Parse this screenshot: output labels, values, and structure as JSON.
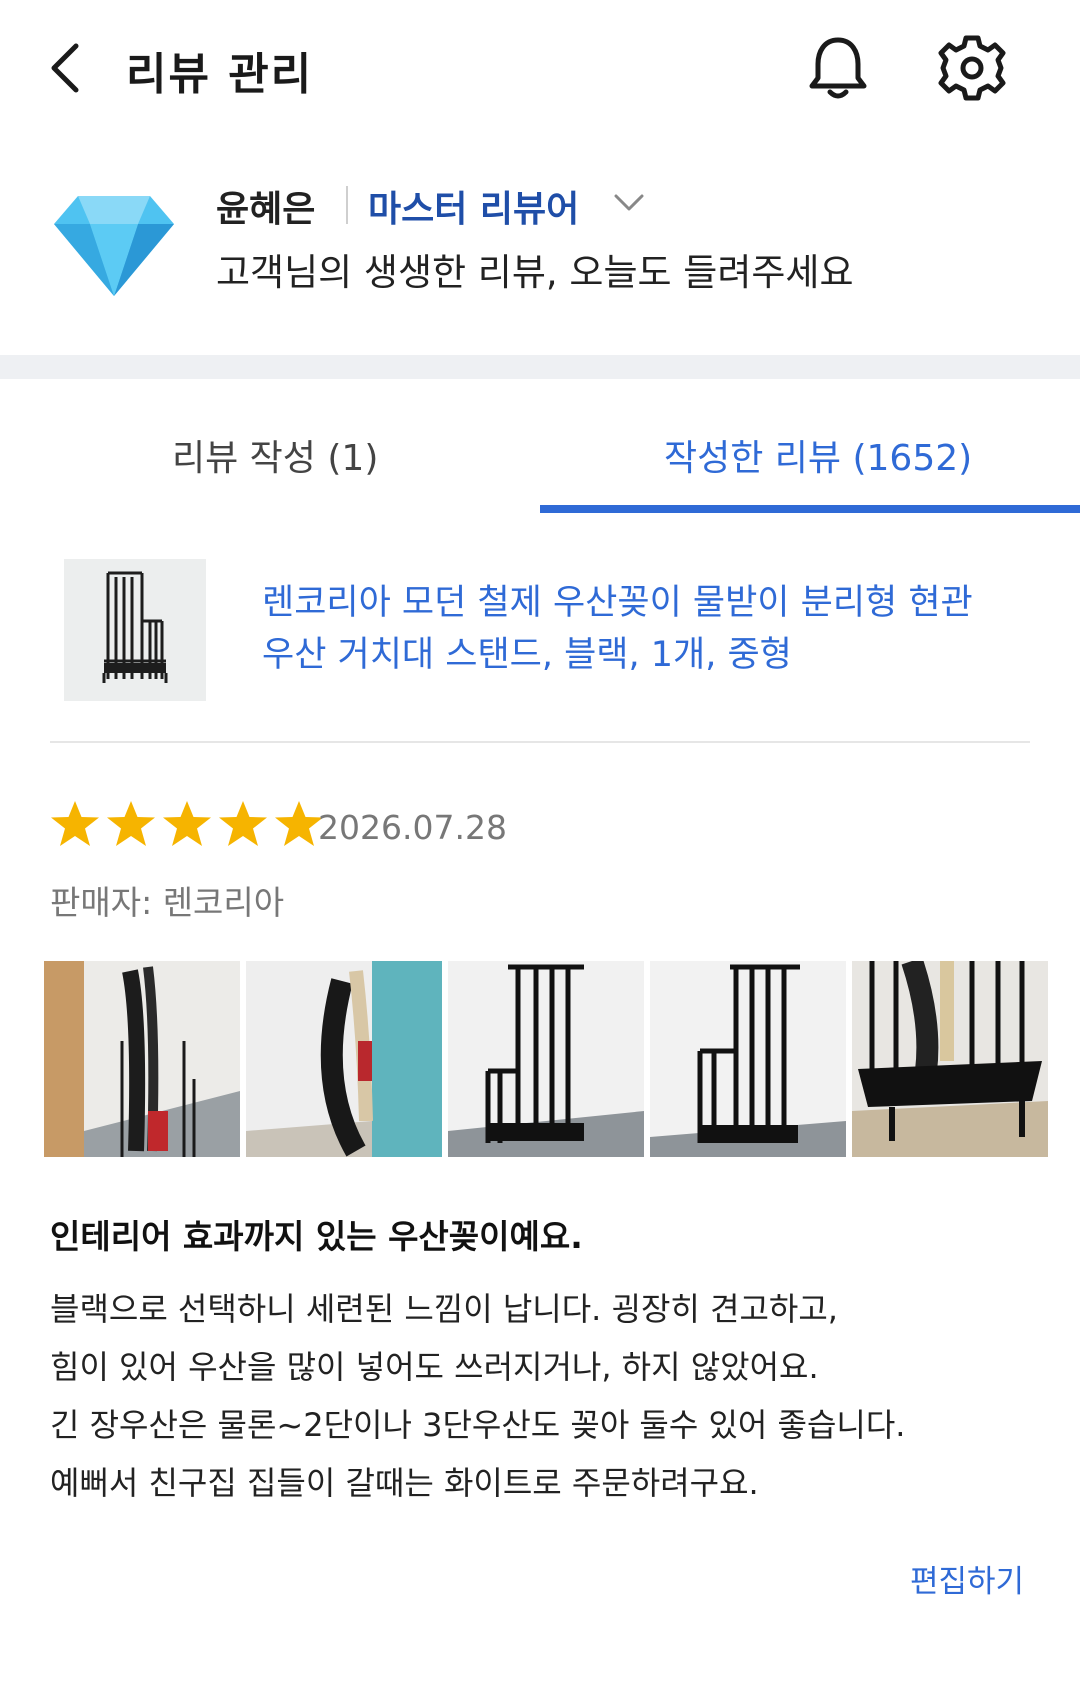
{
  "header": {
    "title": "리뷰 관리",
    "back_icon": "chevron-left-icon",
    "bell_icon": "bell-icon",
    "settings_icon": "gear-icon"
  },
  "profile": {
    "badge_icon": "diamond-icon",
    "user_name": "윤혜은",
    "grade": "마스터 리뷰어",
    "greeting": "고객님의 생생한 리뷰, 오늘도 들려주세요"
  },
  "tabs": [
    {
      "label": "리뷰 작성 (1)",
      "active": false
    },
    {
      "label": "작성한 리뷰 (1652)",
      "active": true
    }
  ],
  "review": {
    "product_name_line1": "렌코리아 모던 철제 우산꽂이 물받이 분리형 현관",
    "product_name_line2": "우산 거치대 스탠드, 블랙, 1개, 중형",
    "rating": 5,
    "date": "2026.07.28",
    "seller": "판매자: 렌코리아",
    "photo_count": 5,
    "title": "인테리어 효과까지 있는 우산꽂이예요.",
    "body": [
      "블랙으로 선택하니 세련된 느낌이 납니다. 굉장히 견고하고,",
      "힘이 있어 우산을 많이 넣어도 쓰러지거나, 하지 않았어요.",
      "긴 장우산은 물론~2단이나 3단우산도 꽂아 둘수 있어 좋습니다.",
      "예뻐서 친구집 집들이 갈때는 화이트로 주문하려구요."
    ],
    "edit_label": "편집하기"
  },
  "colors": {
    "accent": "#2f6ad6",
    "grade": "#1f4ea8",
    "star": "#f6b400",
    "muted": "#777777",
    "band": "#eef0f3"
  }
}
